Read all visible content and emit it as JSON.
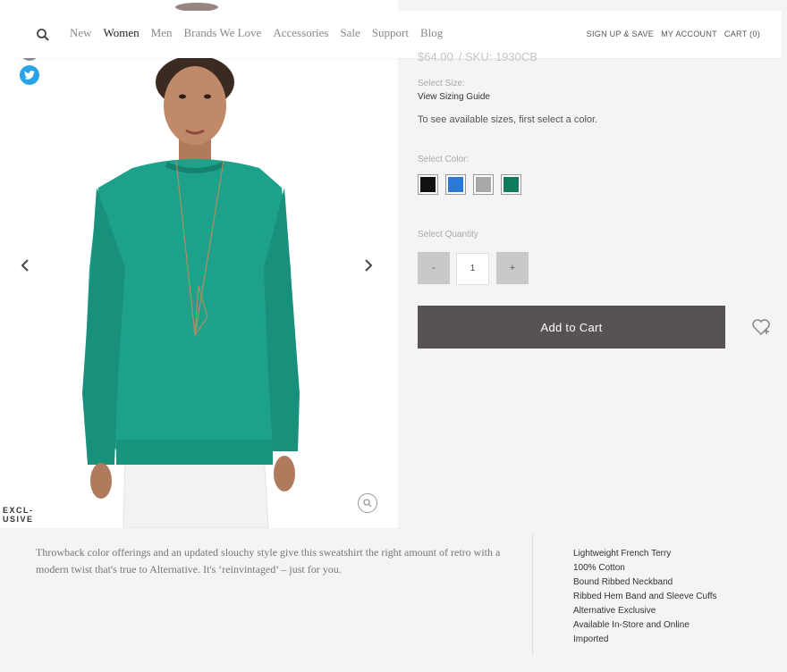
{
  "nav": {
    "links": [
      "New",
      "Women",
      "Men",
      "Brands We Love",
      "Accessories",
      "Sale",
      "Support",
      "Blog"
    ],
    "active": "Women",
    "right": [
      "SIGN UP & SAVE",
      "MY ACCOUNT",
      "CART (0)"
    ]
  },
  "product": {
    "badge_line1": "EXCL-",
    "badge_line2": "USIVE",
    "price": "$64.00",
    "sku": "/ SKU: 1930CB",
    "select_size_label": "Select Size:",
    "sizing_guide": "View Sizing Guide",
    "size_hint": "To see available sizes, first select a color.",
    "select_color_label": "Select Color:",
    "colors": [
      {
        "name": "black",
        "hex": "#111111"
      },
      {
        "name": "blue",
        "hex": "#2b79d6"
      },
      {
        "name": "grey",
        "hex": "#a8a8a8"
      },
      {
        "name": "green",
        "hex": "#0f7a5c"
      }
    ],
    "select_quantity_label": "Select Quantity",
    "minus": "-",
    "plus": "+",
    "quantity": "1",
    "add_to_cart": "Add to Cart"
  },
  "description": {
    "text": "Throwback color offerings and an updated slouchy style give this sweatshirt the right amount of retro with a modern twist that's true to Alternative. It's ‘reinvintaged’ – just for you.",
    "features": [
      "Lightweight French Terry",
      "100% Cotton",
      "Bound Ribbed Neckband",
      "Ribbed Hem Band and Sleeve Cuffs",
      "Alternative Exclusive",
      "Available In-Store and Online",
      "Imported"
    ]
  },
  "colors": {
    "sweater": "#1ea18a",
    "accent_button": "#575253",
    "background": "#f4f3f5"
  }
}
